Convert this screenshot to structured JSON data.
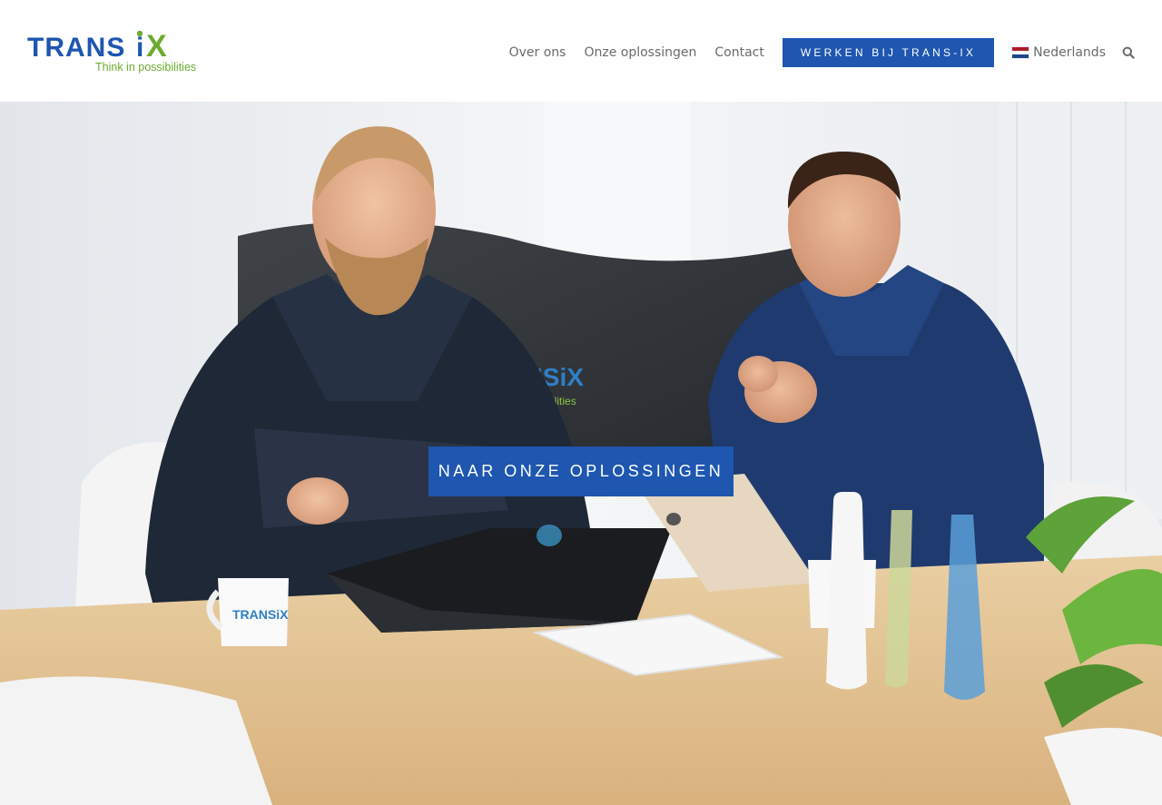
{
  "brand": {
    "logo_text": "TRANSiX",
    "tagline": "Think in possibilities",
    "primary_color": "#1e56b0",
    "accent_green": "#6cab2e"
  },
  "nav": {
    "items": [
      {
        "label": "Over ons"
      },
      {
        "label": "Onze oplossingen"
      },
      {
        "label": "Contact"
      }
    ],
    "cta_label": "WERKEN BIJ TRANS-IX",
    "language": {
      "label": "Nederlands",
      "flag_icon": "netherlands-flag-icon"
    },
    "search_icon": "search-icon"
  },
  "hero": {
    "cta_label": "NAAR ONZE OPLOSSINGEN",
    "image_subject": "photo"
  }
}
